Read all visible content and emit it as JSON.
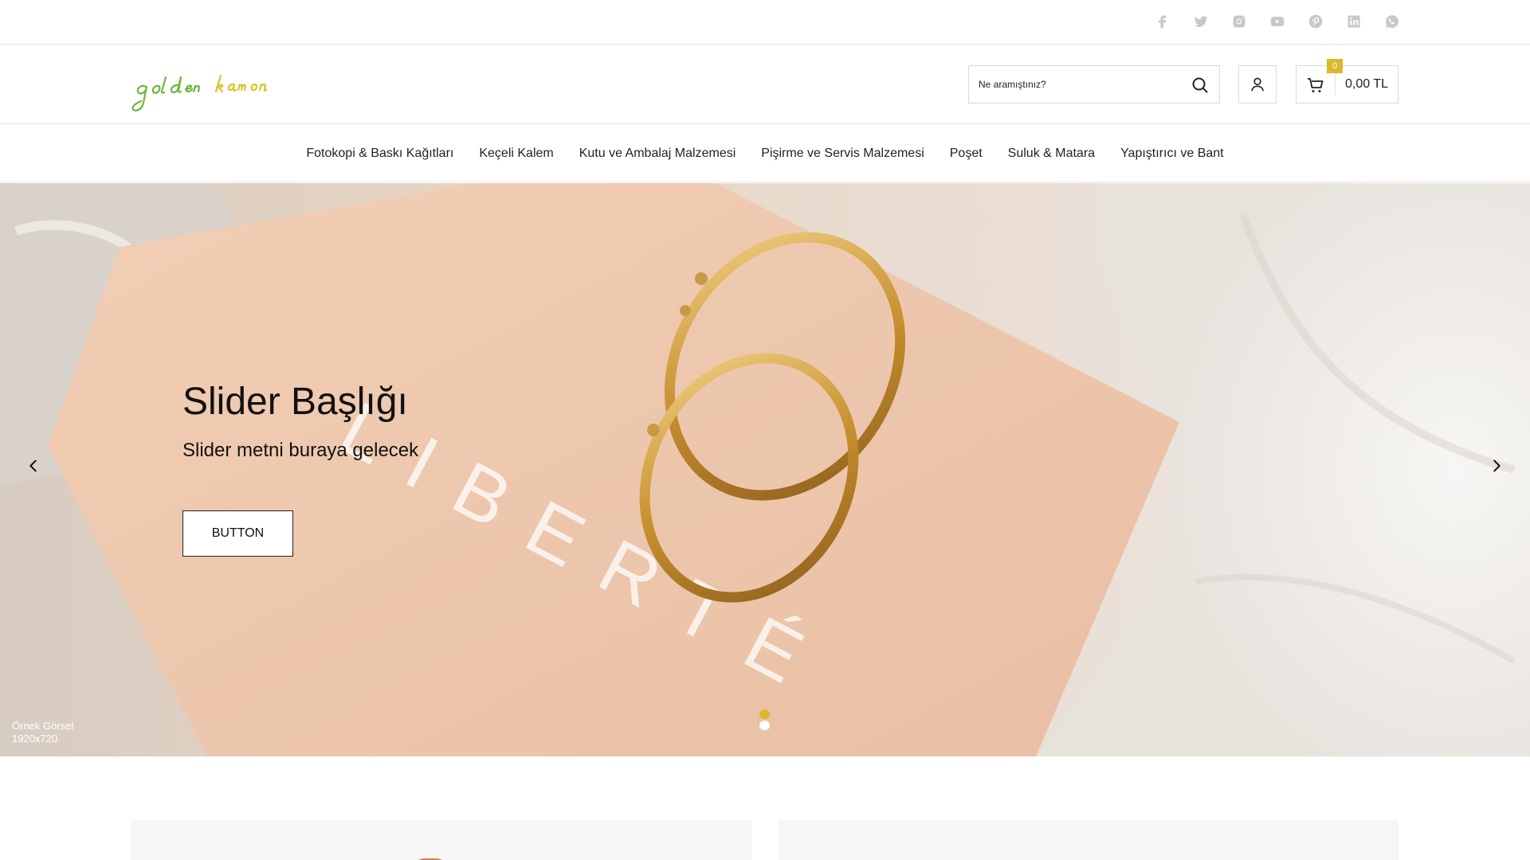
{
  "social": {
    "icons": [
      "facebook-icon",
      "twitter-icon",
      "instagram-icon",
      "youtube-icon",
      "pinterest-icon",
      "linkedin-icon",
      "whatsapp-icon"
    ],
    "color": "#c8c8c8"
  },
  "header": {
    "logo_text": "golden kamon",
    "search": {
      "placeholder": "Ne aramıştınız?"
    },
    "cart": {
      "count": "0",
      "total": "0,00 TL"
    }
  },
  "nav": {
    "items": [
      "Fotokopi & Baskı Kağıtları",
      "Keçeli Kalem",
      "Kutu ve Ambalaj Malzemesi",
      "Pişirme ve Servis Malzemesi",
      "Poşet",
      "Suluk & Matara",
      "Yapıştırıcı ve Bant"
    ]
  },
  "slider": {
    "title": "Slider Başlığı",
    "text": "Slider metni buraya gelecek",
    "button_label": "BUTTON",
    "sample_line1": "Örnek Görsel",
    "sample_line2": "1920x720",
    "box_text": "LIBERTÉ",
    "active_slide": 1,
    "slide_count": 2
  },
  "colors": {
    "accent": "#d9b82a",
    "logo_green": "#6fb53a",
    "logo_yellow": "#d7c62a",
    "text": "#222222"
  }
}
